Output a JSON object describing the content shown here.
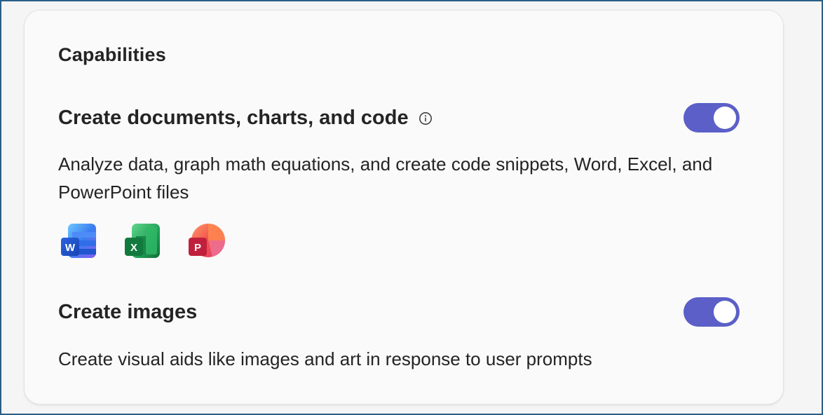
{
  "card": {
    "title": "Capabilities"
  },
  "sections": [
    {
      "title": "Create documents, charts, and code",
      "has_info_icon": true,
      "toggle_on": true,
      "description": "Analyze data, graph math equations, and create code snippets, Word, Excel, and PowerPoint files",
      "app_icons": [
        {
          "name": "word-icon",
          "letter": "W"
        },
        {
          "name": "excel-icon",
          "letter": "X"
        },
        {
          "name": "powerpoint-icon",
          "letter": "P"
        }
      ]
    },
    {
      "title": "Create images",
      "toggle_on": true,
      "description": "Create visual aids like images and art in response to user prompts"
    }
  ],
  "colors": {
    "toggle_accent": "#5b5fc7",
    "frame_border": "#2b5f86",
    "word": "#185abd",
    "excel": "#107c41",
    "powerpoint": "#c43e1c"
  }
}
